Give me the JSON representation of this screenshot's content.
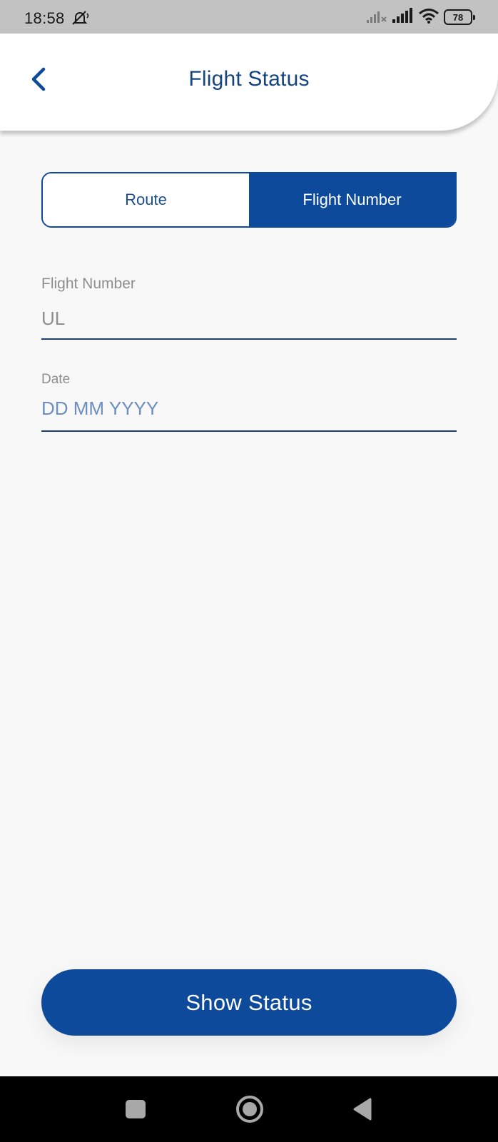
{
  "status_bar": {
    "time": "18:58",
    "battery": "78",
    "icons": [
      "mute-icon",
      "signal-1-icon",
      "signal-2-icon",
      "wifi-icon",
      "battery-icon"
    ]
  },
  "header": {
    "title": "Flight Status",
    "back_icon": "chevron-left-icon"
  },
  "segment": {
    "route_label": "Route",
    "flight_number_label": "Flight Number",
    "selected": "Flight Number"
  },
  "form": {
    "flight_number_label": "Flight Number",
    "flight_number_value": "UL",
    "date_label": "Date",
    "date_placeholder": "DD MM YYYY"
  },
  "actions": {
    "show_status_label": "Show Status"
  },
  "colors": {
    "primary": "#0e4a9b",
    "title": "#15447f",
    "background": "#f8f8f9",
    "statusbar": "#c2c2c2"
  }
}
